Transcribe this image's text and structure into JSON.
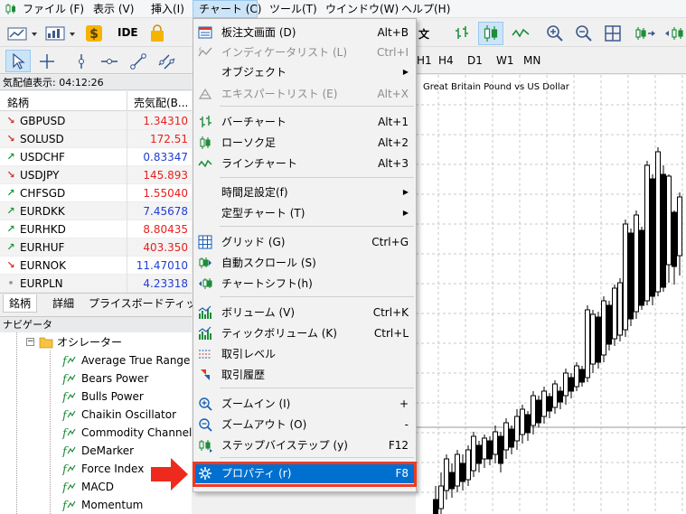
{
  "menubar": {
    "items": [
      {
        "label": "ファイル (F)"
      },
      {
        "label": "表示 (V)"
      },
      {
        "label": "挿入(I)"
      },
      {
        "label": "チャート (C)"
      },
      {
        "label": "ツール(T)"
      },
      {
        "label": "ウインドウ(W)"
      },
      {
        "label": "ヘルプ(H)"
      }
    ]
  },
  "toolbar": {
    "ide_label": "IDE",
    "order_label": "文",
    "timeframes": [
      "H1",
      "H4",
      "D1",
      "W1",
      "MN"
    ]
  },
  "market_watch": {
    "title": "気配値表示: 04:12:26",
    "col_symbol": "銘柄",
    "col_bid": "売気配(B...",
    "rows": [
      {
        "dir": "down",
        "symbol": "GBPUSD",
        "bid": "1.34310",
        "color": "#e8201e"
      },
      {
        "dir": "down",
        "symbol": "SOLUSD",
        "bid": "172.51",
        "color": "#e8201e"
      },
      {
        "dir": "up",
        "symbol": "USDCHF",
        "bid": "0.83347",
        "color": "#1f3ed6"
      },
      {
        "dir": "down",
        "symbol": "USDJPY",
        "bid": "145.893",
        "color": "#e8201e"
      },
      {
        "dir": "up",
        "symbol": "CHFSGD",
        "bid": "1.55040",
        "color": "#e8201e"
      },
      {
        "dir": "up",
        "symbol": "EURDKK",
        "bid": "7.45678",
        "color": "#1f3ed6"
      },
      {
        "dir": "up",
        "symbol": "EURHKD",
        "bid": "8.80435",
        "color": "#e8201e"
      },
      {
        "dir": "up",
        "symbol": "EURHUF",
        "bid": "403.350",
        "color": "#e8201e"
      },
      {
        "dir": "down",
        "symbol": "EURNOK",
        "bid": "11.47010",
        "color": "#1f3ed6"
      },
      {
        "dir": "none",
        "symbol": "EURPLN",
        "bid": "4.23318",
        "color": "#1f3ed6"
      }
    ],
    "tabs": [
      "銘柄",
      "詳細",
      "プライスボード",
      "ティック"
    ]
  },
  "navigator": {
    "title": "ナビゲータ",
    "folder": "オシレーター",
    "items": [
      "Average True Range",
      "Bears Power",
      "Bulls Power",
      "Chaikin Oscillator",
      "Commodity Channel Index",
      "DeMarker",
      "Force Index",
      "MACD",
      "Momentum"
    ]
  },
  "chart": {
    "title": "Great Britain Pound vs US Dollar"
  },
  "chart_menu": {
    "items": [
      {
        "label": "板注文画面 (D)",
        "shortcut": "Alt+B",
        "icon": "order-book-icon",
        "disabled": false
      },
      {
        "label": "インディケータリスト (L)",
        "shortcut": "Ctrl+I",
        "icon": "indicator-list-icon",
        "disabled": true
      },
      {
        "label": "オブジェクト",
        "shortcut": "",
        "icon": "",
        "disabled": false,
        "submenu": true
      },
      {
        "label": "エキスパートリスト (E)",
        "shortcut": "Alt+X",
        "icon": "expert-list-icon",
        "disabled": true
      },
      {
        "label": "バーチャート",
        "shortcut": "Alt+1",
        "icon": "bar-chart-icon",
        "disabled": false
      },
      {
        "label": "ローソク足",
        "shortcut": "Alt+2",
        "icon": "candlestick-icon",
        "disabled": false
      },
      {
        "label": "ラインチャート",
        "shortcut": "Alt+3",
        "icon": "line-chart-icon",
        "disabled": false
      },
      {
        "label": "時間足設定(f)",
        "shortcut": "",
        "icon": "",
        "disabled": false,
        "submenu": true
      },
      {
        "label": "定型チャート (T)",
        "shortcut": "",
        "icon": "",
        "disabled": false,
        "submenu": true
      },
      {
        "label": "グリッド (G)",
        "shortcut": "Ctrl+G",
        "icon": "grid-icon",
        "disabled": false
      },
      {
        "label": "自動スクロール (S)",
        "shortcut": "",
        "icon": "auto-scroll-icon",
        "disabled": false
      },
      {
        "label": "チャートシフト(h)",
        "shortcut": "",
        "icon": "chart-shift-icon",
        "disabled": false
      },
      {
        "label": "ボリューム (V)",
        "shortcut": "Ctrl+K",
        "icon": "volume-icon",
        "disabled": false
      },
      {
        "label": "ティックボリューム (K)",
        "shortcut": "Ctrl+L",
        "icon": "tick-volume-icon",
        "disabled": false
      },
      {
        "label": "取引レベル",
        "shortcut": "",
        "icon": "trade-levels-icon",
        "disabled": false
      },
      {
        "label": "取引履歴",
        "shortcut": "",
        "icon": "trade-history-icon",
        "disabled": false
      },
      {
        "label": "ズームイン (I)",
        "shortcut": "+",
        "icon": "zoom-in-icon",
        "disabled": false
      },
      {
        "label": "ズームアウト (O)",
        "shortcut": "-",
        "icon": "zoom-out-icon",
        "disabled": false
      },
      {
        "label": "ステップバイステップ (y)",
        "shortcut": "F12",
        "icon": "step-by-step-icon",
        "disabled": false
      },
      {
        "label": "プロパティ (r)",
        "shortcut": "F8",
        "icon": "properties-icon",
        "disabled": false
      }
    ]
  },
  "colors": {
    "accent": "#0070d0",
    "highlight_border": "#ee3a25",
    "arrow": "#ee2a1e",
    "bid_down": "#e8201e",
    "bid_up": "#1f3ed6",
    "arrow_down": "#d2372c",
    "arrow_up": "#1e9b3c"
  }
}
